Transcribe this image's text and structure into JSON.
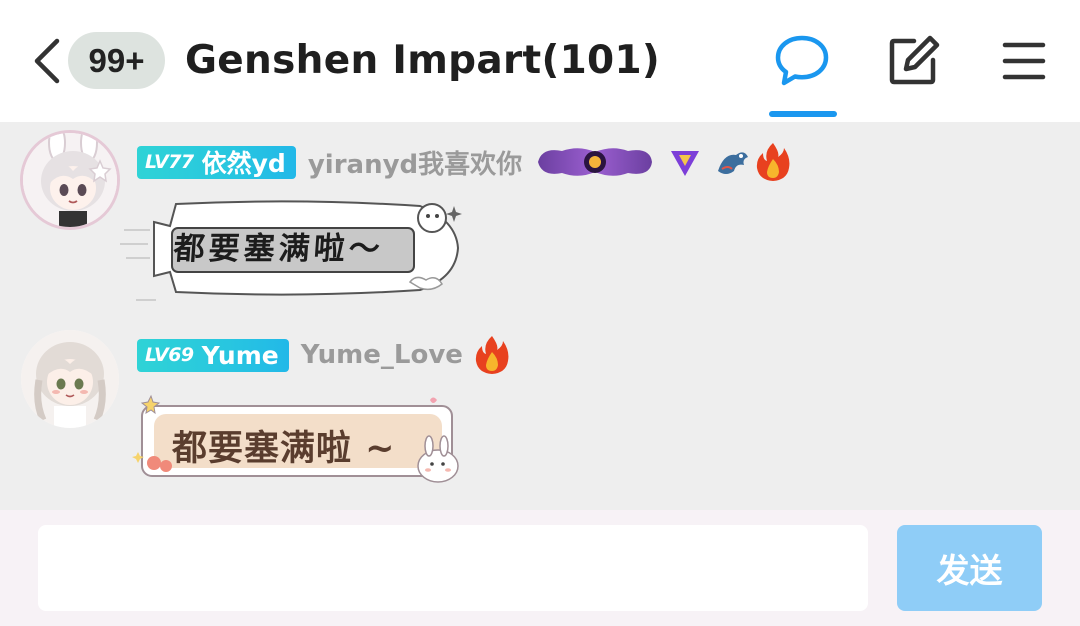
{
  "header": {
    "unread_count": "99+",
    "title": "Genshen Impart(101)",
    "active_tab_color": "#1a97ef",
    "icons": [
      "back-arrow-icon",
      "chat-bubble-icon",
      "edit-icon",
      "menu-icon"
    ]
  },
  "messages": [
    {
      "level": "LV77",
      "name": "依然yd",
      "nickname": "yiranyd我喜欢你",
      "text": "都要塞满啦～",
      "badges": [
        "purple-nameplate-icon",
        "purple-diamond-icon",
        "dragon-icon",
        "fire-icon"
      ]
    },
    {
      "level": "LV69",
      "name": "Yume",
      "nickname": "Yume_Love",
      "text": "都要塞满啦 ~",
      "badges": [
        "fire-icon"
      ]
    }
  ],
  "composer": {
    "input_value": "",
    "send_label": "发送",
    "send_color": "#8fcdf7"
  },
  "colors": {
    "level_badge": "#28c6e0",
    "chat_background": "#eeeeee",
    "nickname": "#9a9a9a"
  }
}
